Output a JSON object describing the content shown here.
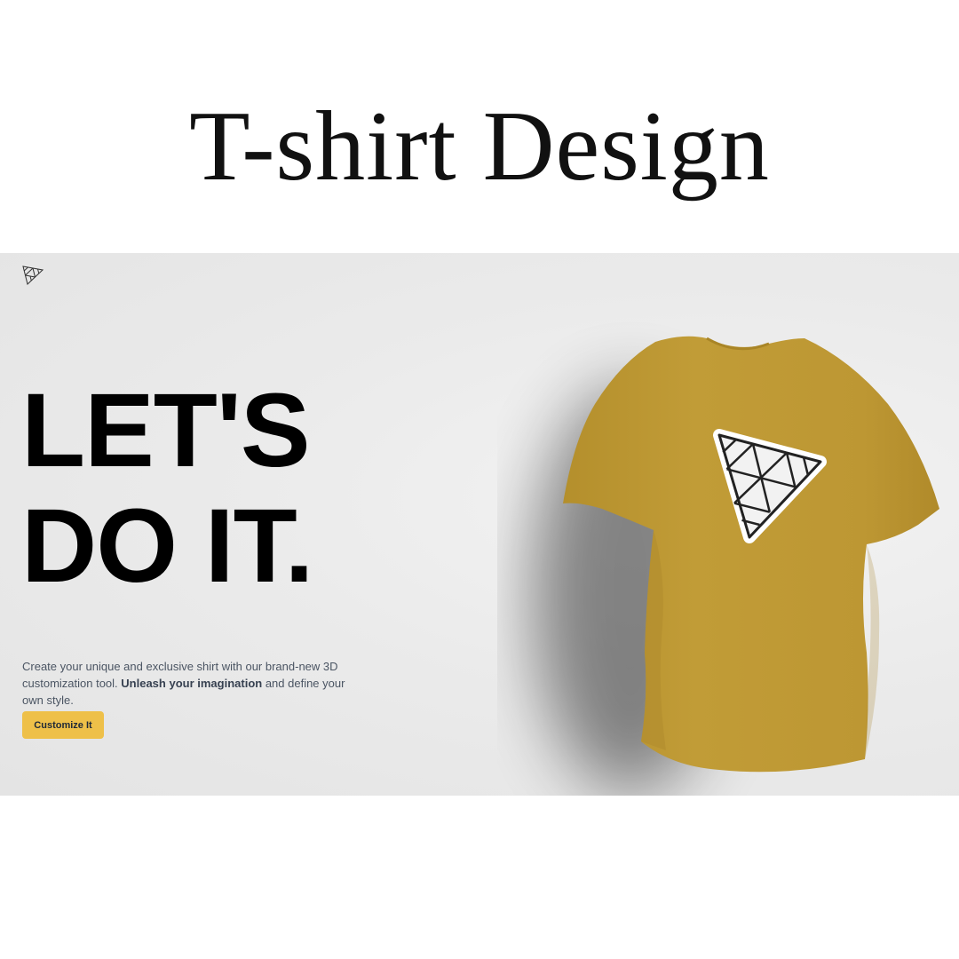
{
  "page": {
    "title": "T-shirt Design"
  },
  "hero": {
    "headline_line1": "LET'S",
    "headline_line2": "DO IT.",
    "description_part1": "Create your unique and exclusive shirt with our brand-new 3D customization tool. ",
    "description_bold": "Unleash your imagination",
    "description_part2": " and define your own style.",
    "cta_label": "Customize It"
  },
  "colors": {
    "accent": "#eec049",
    "shirt": "#bf9a35",
    "background": "#ebebeb",
    "text": "#000000"
  },
  "icons": [
    "triangle-logo-icon",
    "triangle-decal-icon"
  ]
}
